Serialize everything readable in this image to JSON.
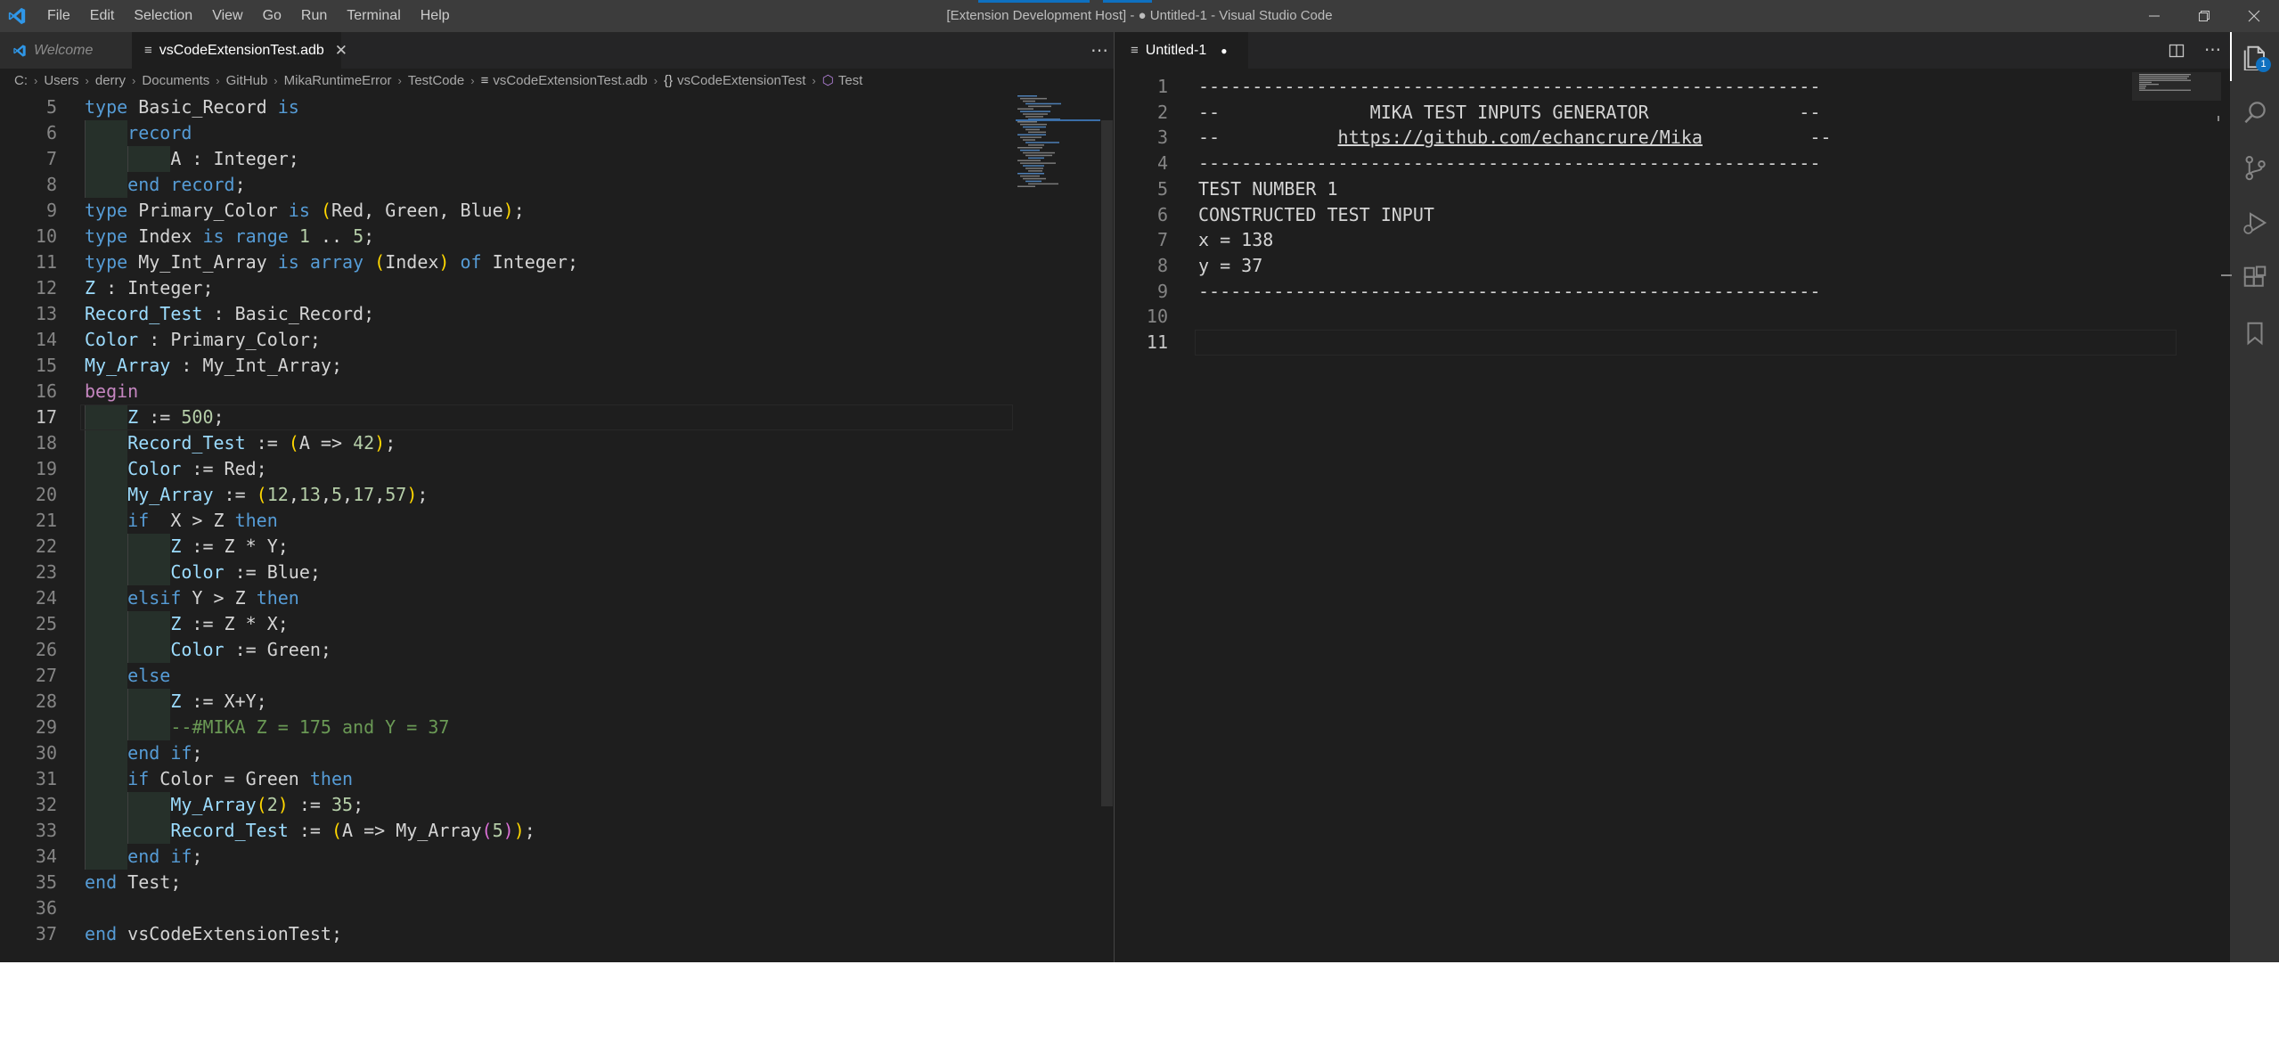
{
  "window": {
    "title": "[Extension Development Host] - ● Untitled-1 - Visual Studio Code",
    "logo_icon": "vscode-logo-icon",
    "controls": [
      "minimize-icon",
      "restore-icon",
      "close-icon"
    ]
  },
  "menu": [
    "File",
    "Edit",
    "Selection",
    "View",
    "Go",
    "Run",
    "Terminal",
    "Help"
  ],
  "left_group": {
    "tabs": [
      {
        "label": "Welcome",
        "icon": "vscode-logo-icon",
        "preview": true
      },
      {
        "label": "vsCodeExtensionTest.adb",
        "icon": "lines-file-icon",
        "active": true,
        "close": "✕"
      }
    ],
    "more_actions": "⋯",
    "breadcrumb": [
      {
        "label": "C:"
      },
      {
        "label": "Users"
      },
      {
        "label": "derry"
      },
      {
        "label": "Documents"
      },
      {
        "label": "GitHub"
      },
      {
        "label": "MikaRuntimeError"
      },
      {
        "label": "TestCode"
      },
      {
        "label": "vsCodeExtensionTest.adb",
        "icon": "≡"
      },
      {
        "label": "vsCodeExtensionTest",
        "icon": "{}"
      },
      {
        "label": "Test",
        "icon": "⬡"
      }
    ],
    "active_line": 17,
    "lines": [
      {
        "n": "5",
        "tokens": [
          [
            "kw",
            "type"
          ],
          [
            "ty",
            " Basic_Record "
          ],
          [
            "kw",
            "is"
          ]
        ]
      },
      {
        "n": "6",
        "tokens": [
          [
            "ty",
            "    "
          ],
          [
            "kw",
            "record"
          ]
        ]
      },
      {
        "n": "7",
        "tokens": [
          [
            "ty",
            "        A : Integer;"
          ]
        ]
      },
      {
        "n": "8",
        "tokens": [
          [
            "ty",
            "    "
          ],
          [
            "kw",
            "end record"
          ],
          [
            "ty",
            ";"
          ]
        ]
      },
      {
        "n": "9",
        "tokens": [
          [
            "kw",
            "type"
          ],
          [
            "ty",
            " Primary_Color "
          ],
          [
            "kw",
            "is"
          ],
          [
            "ty",
            " "
          ],
          [
            "p1",
            "("
          ],
          [
            "ty",
            "Red, Green, Blue"
          ],
          [
            "p1",
            ")"
          ],
          [
            "ty",
            ";"
          ]
        ]
      },
      {
        "n": "10",
        "tokens": [
          [
            "kw",
            "type"
          ],
          [
            "ty",
            " Index "
          ],
          [
            "kw",
            "is"
          ],
          [
            "ty",
            " "
          ],
          [
            "kw",
            "range"
          ],
          [
            "ty",
            " "
          ],
          [
            "num",
            "1"
          ],
          [
            "ty",
            " .. "
          ],
          [
            "num",
            "5"
          ],
          [
            "ty",
            ";"
          ]
        ]
      },
      {
        "n": "11",
        "tokens": [
          [
            "kw",
            "type"
          ],
          [
            "ty",
            " My_Int_Array "
          ],
          [
            "kw",
            "is"
          ],
          [
            "ty",
            " "
          ],
          [
            "kw",
            "array"
          ],
          [
            "ty",
            " "
          ],
          [
            "p1",
            "("
          ],
          [
            "ty",
            "Index"
          ],
          [
            "p1",
            ")"
          ],
          [
            "ty",
            " "
          ],
          [
            "kw",
            "of"
          ],
          [
            "ty",
            " Integer;"
          ]
        ]
      },
      {
        "n": "12",
        "tokens": [
          [
            "id",
            "Z"
          ],
          [
            "ty",
            " : Integer;"
          ]
        ]
      },
      {
        "n": "13",
        "tokens": [
          [
            "id",
            "Record_Test"
          ],
          [
            "ty",
            " : Basic_Record;"
          ]
        ]
      },
      {
        "n": "14",
        "tokens": [
          [
            "id",
            "Color"
          ],
          [
            "ty",
            " : Primary_Color;"
          ]
        ]
      },
      {
        "n": "15",
        "tokens": [
          [
            "id",
            "My_Array"
          ],
          [
            "ty",
            " : My_Int_Array;"
          ]
        ]
      },
      {
        "n": "16",
        "tokens": [
          [
            "kw2",
            "begin"
          ]
        ]
      },
      {
        "n": "17",
        "tokens": [
          [
            "ty",
            "    "
          ],
          [
            "id",
            "Z"
          ],
          [
            "ty",
            " := "
          ],
          [
            "num",
            "500"
          ],
          [
            "ty",
            ";"
          ]
        ]
      },
      {
        "n": "18",
        "tokens": [
          [
            "ty",
            "    "
          ],
          [
            "id",
            "Record_Test"
          ],
          [
            "ty",
            " := "
          ],
          [
            "p1",
            "("
          ],
          [
            "ty",
            "A => "
          ],
          [
            "num",
            "42"
          ],
          [
            "p1",
            ")"
          ],
          [
            "ty",
            ";"
          ]
        ]
      },
      {
        "n": "19",
        "tokens": [
          [
            "ty",
            "    "
          ],
          [
            "id",
            "Color"
          ],
          [
            "ty",
            " := Red;"
          ]
        ]
      },
      {
        "n": "20",
        "tokens": [
          [
            "ty",
            "    "
          ],
          [
            "id",
            "My_Array"
          ],
          [
            "ty",
            " := "
          ],
          [
            "p1",
            "("
          ],
          [
            "num",
            "12"
          ],
          [
            "ty",
            ","
          ],
          [
            "num",
            "13"
          ],
          [
            "ty",
            ","
          ],
          [
            "num",
            "5"
          ],
          [
            "ty",
            ","
          ],
          [
            "num",
            "17"
          ],
          [
            "ty",
            ","
          ],
          [
            "num",
            "57"
          ],
          [
            "p1",
            ")"
          ],
          [
            "ty",
            ";"
          ]
        ]
      },
      {
        "n": "21",
        "tokens": [
          [
            "ty",
            "    "
          ],
          [
            "kw",
            "if"
          ],
          [
            "ty",
            "  X > Z "
          ],
          [
            "kw",
            "then"
          ]
        ]
      },
      {
        "n": "22",
        "tokens": [
          [
            "ty",
            "        "
          ],
          [
            "id",
            "Z"
          ],
          [
            "ty",
            " := Z * Y;"
          ]
        ]
      },
      {
        "n": "23",
        "tokens": [
          [
            "ty",
            "        "
          ],
          [
            "id",
            "Color"
          ],
          [
            "ty",
            " := Blue;"
          ]
        ]
      },
      {
        "n": "24",
        "tokens": [
          [
            "ty",
            "    "
          ],
          [
            "kw",
            "elsif"
          ],
          [
            "ty",
            " Y > Z "
          ],
          [
            "kw",
            "then"
          ]
        ]
      },
      {
        "n": "25",
        "tokens": [
          [
            "ty",
            "        "
          ],
          [
            "id",
            "Z"
          ],
          [
            "ty",
            " := Z * X;"
          ]
        ]
      },
      {
        "n": "26",
        "tokens": [
          [
            "ty",
            "        "
          ],
          [
            "id",
            "Color"
          ],
          [
            "ty",
            " := Green;"
          ]
        ]
      },
      {
        "n": "27",
        "tokens": [
          [
            "ty",
            "    "
          ],
          [
            "kw",
            "else"
          ]
        ]
      },
      {
        "n": "28",
        "tokens": [
          [
            "ty",
            "        "
          ],
          [
            "id",
            "Z"
          ],
          [
            "ty",
            " := X+Y;"
          ]
        ]
      },
      {
        "n": "29",
        "tokens": [
          [
            "ty",
            "        "
          ],
          [
            "cmt",
            "--#MIKA Z = 175 and Y = 37"
          ]
        ]
      },
      {
        "n": "30",
        "tokens": [
          [
            "ty",
            "    "
          ],
          [
            "kw",
            "end if"
          ],
          [
            "ty",
            ";"
          ]
        ]
      },
      {
        "n": "31",
        "tokens": [
          [
            "ty",
            "    "
          ],
          [
            "kw",
            "if"
          ],
          [
            "ty",
            " Color = Green "
          ],
          [
            "kw",
            "then"
          ]
        ]
      },
      {
        "n": "32",
        "tokens": [
          [
            "ty",
            "        "
          ],
          [
            "id",
            "My_Array"
          ],
          [
            "p1",
            "("
          ],
          [
            "num",
            "2"
          ],
          [
            "p1",
            ")"
          ],
          [
            "ty",
            " := "
          ],
          [
            "num",
            "35"
          ],
          [
            "ty",
            ";"
          ]
        ]
      },
      {
        "n": "33",
        "tokens": [
          [
            "ty",
            "        "
          ],
          [
            "id",
            "Record_Test"
          ],
          [
            "ty",
            " := "
          ],
          [
            "p1",
            "("
          ],
          [
            "ty",
            "A => My_Array"
          ],
          [
            "p2",
            "("
          ],
          [
            "num",
            "5"
          ],
          [
            "p2",
            ")"
          ],
          [
            "p1",
            ")"
          ],
          [
            "ty",
            ";"
          ]
        ]
      },
      {
        "n": "34",
        "tokens": [
          [
            "ty",
            "    "
          ],
          [
            "kw",
            "end if"
          ],
          [
            "ty",
            ";"
          ]
        ]
      },
      {
        "n": "35",
        "tokens": [
          [
            "kw",
            "end"
          ],
          [
            "ty",
            " Test;"
          ]
        ]
      },
      {
        "n": "36",
        "tokens": []
      },
      {
        "n": "37",
        "tokens": [
          [
            "kw",
            "end"
          ],
          [
            "ty",
            " vsCodeExtensionTest;"
          ]
        ]
      }
    ]
  },
  "right_group": {
    "tabs": [
      {
        "label": "Untitled-1",
        "icon": "lines-file-icon",
        "active": true,
        "dirty": "●"
      }
    ],
    "actions": [
      "split-editor-icon",
      "more-actions-icon"
    ],
    "more_actions": "⋯",
    "active_line": 11,
    "lines": [
      {
        "n": "1",
        "text": "----------------------------------------------------------"
      },
      {
        "n": "2",
        "text": "--              MIKA TEST INPUTS GENERATOR              --"
      },
      {
        "n": "3",
        "text": "--           ",
        "link": "https://github.com/echancrure/Mika",
        "after": "          --"
      },
      {
        "n": "4",
        "text": "----------------------------------------------------------"
      },
      {
        "n": "5",
        "text": "TEST NUMBER 1"
      },
      {
        "n": "6",
        "text": "CONSTRUCTED TEST INPUT"
      },
      {
        "n": "7",
        "text": "x = 138"
      },
      {
        "n": "8",
        "text": "y = 37"
      },
      {
        "n": "9",
        "text": "----------------------------------------------------------"
      },
      {
        "n": "10",
        "text": ""
      },
      {
        "n": "11",
        "text": ""
      }
    ]
  },
  "activity_bar": [
    {
      "name": "explorer",
      "icon": "files-icon",
      "badge": "1",
      "active": true
    },
    {
      "name": "search",
      "icon": "search-icon"
    },
    {
      "name": "source-control",
      "icon": "source-control-icon"
    },
    {
      "name": "run-and-debug",
      "icon": "run-debug-icon"
    },
    {
      "name": "extensions",
      "icon": "extensions-icon"
    },
    {
      "name": "bookmarks",
      "icon": "bookmark-icon"
    }
  ],
  "colors": {
    "titlebar": "#3c3c3c",
    "editor_bg": "#1e1e1e",
    "tabbar_bg": "#252526",
    "activitybar_bg": "#333333",
    "accent": "#0e70c0",
    "keyword": "#569cd6",
    "control_keyword": "#c586c0",
    "identifier": "#9cdcfe",
    "number": "#b5cea8",
    "comment": "#6a9955",
    "bracket": "#ffd700"
  }
}
